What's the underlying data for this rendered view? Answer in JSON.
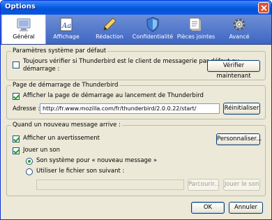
{
  "window": {
    "title": "Options"
  },
  "tabs": [
    {
      "label": "Général",
      "icon": "general-icon",
      "selected": true
    },
    {
      "label": "Affichage",
      "icon": "display-icon",
      "selected": false
    },
    {
      "label": "Rédaction",
      "icon": "composition-icon",
      "selected": false
    },
    {
      "label": "Confidentialité",
      "icon": "privacy-icon",
      "selected": false
    },
    {
      "label": "Pièces jointes",
      "icon": "attachments-icon",
      "selected": false
    },
    {
      "label": "Avancé",
      "icon": "advanced-icon",
      "selected": false
    }
  ],
  "system_defaults": {
    "title": "Paramètres système par défaut",
    "check_default_label_line1": "Toujours vérifier si Thunderbird est le client de messagerie par défaut au",
    "check_default_label_line2": "démarrage :",
    "check_default_checked": false,
    "check_now_button": "Vérifier maintenant"
  },
  "startup": {
    "title": "Page de démarrage de Thunderbird",
    "show_start_page_label": "Afficher la page de démarrage au lancement de Thunderbird",
    "show_start_page_checked": true,
    "address_label": "Adresse :",
    "address_value": "http://fr.www.mozilla.com/fr/thunderbird/2.0.0.22/start/",
    "reset_button": "Réinitialiser"
  },
  "new_message": {
    "title": "Quand un nouveau message arrive :",
    "show_alert_label": "Afficher un avertissement",
    "show_alert_checked": true,
    "customize_button": "Personnaliser...",
    "play_sound_label": "Jouer un son",
    "play_sound_checked": true,
    "system_sound_label": "Son système pour « nouveau message »",
    "system_sound_selected": true,
    "custom_file_label": "Utiliser le fichier son suivant :",
    "custom_file_selected": false,
    "sound_file_value": "",
    "browse_button": "Parcourir...",
    "play_button": "Jouer le son"
  },
  "footer": {
    "ok_button": "OK",
    "cancel_button": "Annuler"
  },
  "colors": {
    "titlebar": "#0a5fe5",
    "toolbar": "#3e66c4",
    "dialog_bg": "#ece9d8",
    "checkmark": "#21a121"
  }
}
